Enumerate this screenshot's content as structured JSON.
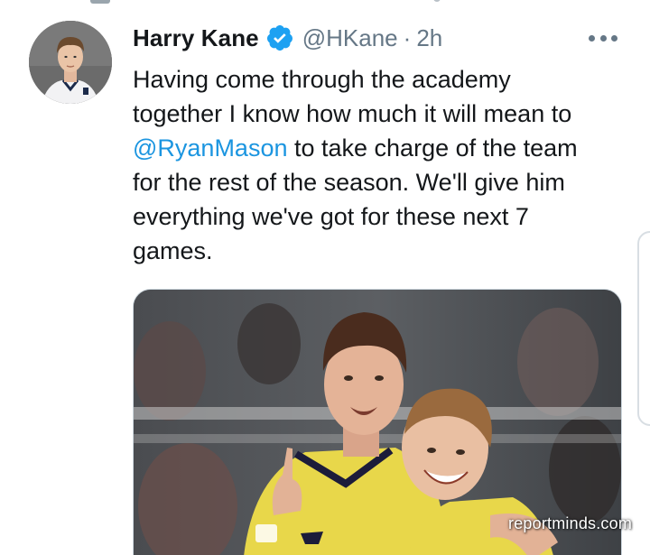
{
  "tweet": {
    "author": {
      "display_name": "Harry Kane",
      "verified": true,
      "handle": "@HKane",
      "separator": "·",
      "time": "2h"
    },
    "text_lines": {
      "l1": "Having come through the academy",
      "l2": "together I know how much it will mean to",
      "l3_mention": "@RyanMason",
      "l3_rest": " to take charge of the team",
      "l4": "for the rest of the season. We'll give him",
      "l5": "everything we've got for these next 7",
      "l6": "games."
    },
    "media": {
      "watermark": "reportminds.com"
    }
  },
  "icons": {
    "verified": "verified-badge-icon",
    "more": "more-options-icon"
  },
  "colors": {
    "text": "#14171a",
    "secondary": "#657786",
    "link": "#1b95e0",
    "verified": "#1da1f2",
    "border": "#ccd6dd"
  }
}
